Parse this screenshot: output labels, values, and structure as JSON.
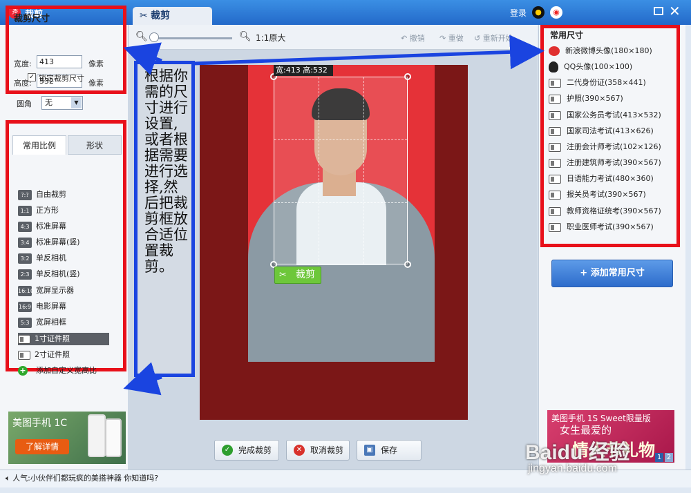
{
  "titlebar": {
    "app_title": "裁剪",
    "tab": "裁剪",
    "login": "登录"
  },
  "crop_size": {
    "title": "裁剪尺寸",
    "width_label": "宽度:",
    "width_value": "413",
    "height_label": "高度:",
    "height_value": "532",
    "unit": "像素",
    "lock_label": "锁定裁剪尺寸",
    "lock_checked": true,
    "corner_label": "圆角",
    "corner_value": "无"
  },
  "ratio_tabs": [
    "常用比例",
    "形状"
  ],
  "ratios": [
    {
      "badge": "?:?",
      "label": "自由裁剪"
    },
    {
      "badge": "1:1",
      "label": "正方形"
    },
    {
      "badge": "4:3",
      "label": "标准屏幕"
    },
    {
      "badge": "3:4",
      "label": "标准屏幕(竖)"
    },
    {
      "badge": "3:2",
      "label": "单反相机"
    },
    {
      "badge": "2:3",
      "label": "单反相机(竖)"
    },
    {
      "badge": "16:10",
      "label": "宽屏显示器"
    },
    {
      "badge": "16:9",
      "label": "电影屏幕"
    },
    {
      "badge": "5:3",
      "label": "宽屏相框"
    },
    {
      "badge": "",
      "label": "1寸证件照",
      "selected": true
    },
    {
      "badge": "",
      "label": "2寸证件照"
    }
  ],
  "add_custom_ratio": "添加自定义宽高比",
  "toolbar": {
    "original": "1:1原大",
    "undo": "撤销",
    "redo": "重做",
    "restart": "重新开始",
    "zoom": 0.0
  },
  "canvas": {
    "dims": "宽:413 高:532",
    "crop_button": "裁剪"
  },
  "annotation": "根据你需的尺寸进行设置,或者根据需要进行选择,然后把裁剪框放合适位置裁剪。",
  "bottom_buttons": {
    "done": "完成裁剪",
    "cancel": "取消裁剪",
    "save": "保存"
  },
  "common_sizes": {
    "title": "常用尺寸",
    "items": [
      {
        "icon": "weibo-icon",
        "label": "新浪微博头像(180×180)"
      },
      {
        "icon": "qq-icon",
        "label": "QQ头像(100×100)"
      },
      {
        "icon": "id-card-icon",
        "label": "二代身份证(358×441)"
      },
      {
        "icon": "id-card-icon",
        "label": "护照(390×567)"
      },
      {
        "icon": "id-card-icon",
        "label": "国家公务员考试(413×532)"
      },
      {
        "icon": "id-card-icon",
        "label": "国家司法考试(413×626)"
      },
      {
        "icon": "id-card-icon",
        "label": "注册会计师考试(102×126)"
      },
      {
        "icon": "id-card-icon",
        "label": "注册建筑师考试(390×567)"
      },
      {
        "icon": "id-card-icon",
        "label": "日语能力考试(480×360)"
      },
      {
        "icon": "id-card-icon",
        "label": "报关员考试(390×567)"
      },
      {
        "icon": "id-card-icon",
        "label": "教师资格证统考(390×567)"
      },
      {
        "icon": "id-card-icon",
        "label": "职业医师考试(390×567)"
      }
    ],
    "add_button": "添加常用尺寸"
  },
  "ads": {
    "left_title": "美图手机 1C",
    "left_button": "了解详情",
    "right_title": "美图手机 1S Sweet限量版",
    "right_sub": "女生最爱的",
    "right_big": "情人节礼物",
    "pages": [
      "1",
      "2"
    ]
  },
  "status": "人气:小伙伴们都玩疯的美搭神器 你知道吗?",
  "watermark": {
    "logo": "Baidu 经验",
    "url": "jingyan.baidu.com"
  },
  "colors": {
    "titlebar": "#2a74d0",
    "highlight_red": "#e8101a",
    "highlight_blue": "#1a44e0",
    "crop_green": "#6dc73a",
    "canvas_bg": "#7b1717",
    "photo_bg": "#e53238"
  }
}
